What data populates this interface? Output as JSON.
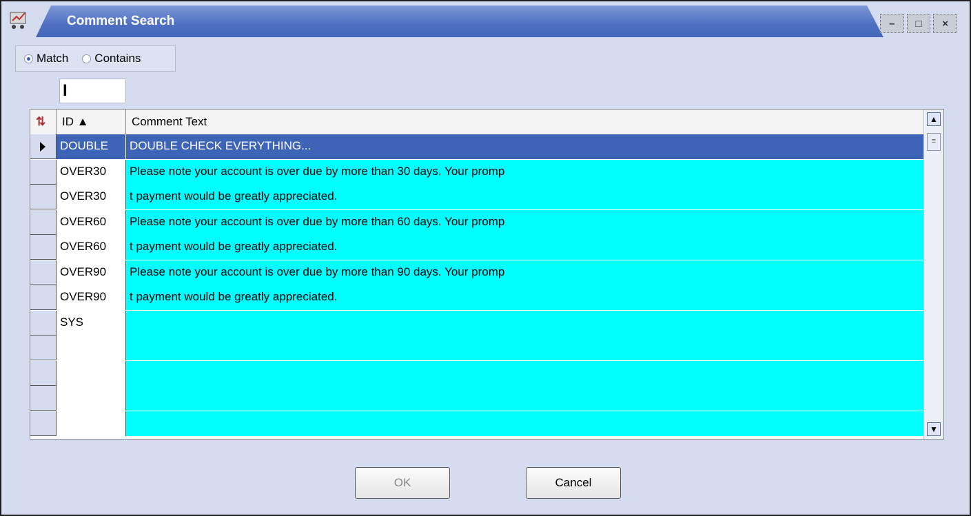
{
  "window": {
    "title": "Comment Search",
    "controls": [
      "minimize-icon",
      "maximize-icon",
      "close-icon"
    ],
    "control_glyphs": [
      "–",
      "□",
      "×"
    ]
  },
  "search_mode": {
    "options": [
      {
        "label": "Match",
        "selected": true
      },
      {
        "label": "Contains",
        "selected": false
      }
    ]
  },
  "search": {
    "value": "I"
  },
  "grid": {
    "columns": {
      "id": "ID ▲",
      "comment": "Comment Text"
    },
    "rows": [
      {
        "id": "DOUBLE",
        "text": "DOUBLE CHECK EVERYTHING...",
        "selected": true
      },
      {
        "id": "OVER30",
        "text": "Please note your account is over due by more than 30 days.  Your promp"
      },
      {
        "id": "OVER30",
        "text": "t payment would be greatly appreciated."
      },
      {
        "id": "OVER60",
        "text": "Please note your account is over due by more than 60 days.  Your promp"
      },
      {
        "id": "OVER60",
        "text": "t payment would be greatly appreciated."
      },
      {
        "id": "OVER90",
        "text": "Please note your account is over due by more than 90 days.  Your promp"
      },
      {
        "id": "OVER90",
        "text": "t payment would be greatly appreciated."
      },
      {
        "id": "SYS",
        "text": ""
      },
      {
        "id": "",
        "text": ""
      },
      {
        "id": "",
        "text": ""
      },
      {
        "id": "",
        "text": ""
      },
      {
        "id": "",
        "text": ""
      }
    ]
  },
  "buttons": {
    "ok": "OK",
    "cancel": "Cancel"
  },
  "colors": {
    "row_bg": "#00ffff",
    "selected_bg": "#3d64b7",
    "title_bar": "#4f6fc1"
  }
}
